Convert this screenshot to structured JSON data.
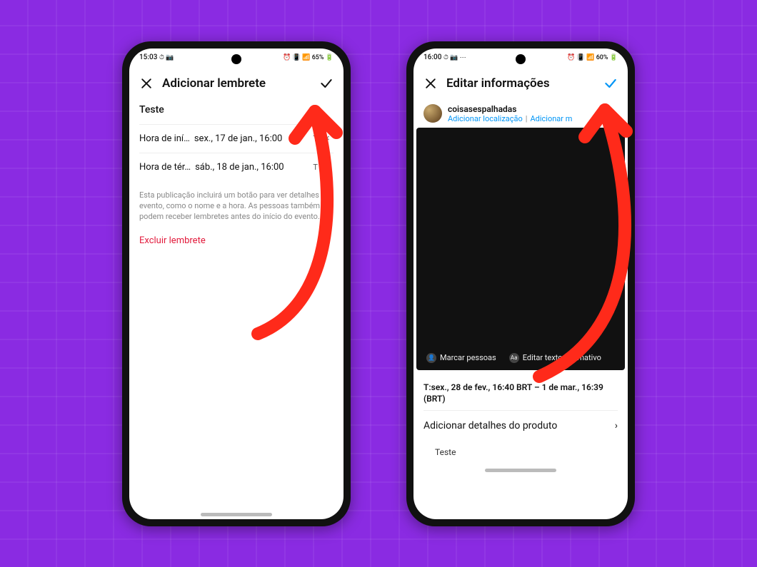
{
  "colors": {
    "accent": "#0095f6",
    "danger": "#e21b3c",
    "bg": "#8a2be2"
  },
  "phone1": {
    "statusbar": {
      "time": "15:03",
      "left_icons": "⏱ 📷",
      "right_icons": "⏰ 📳 📶 65% 🔋",
      "battery": "65%"
    },
    "appbar": {
      "title": "Adicionar lembrete"
    },
    "title": "Teste",
    "start": {
      "label": "Hora de iní…",
      "value": "sex., 17 de jan., 16:00",
      "tz": "T"
    },
    "end": {
      "label": "Hora de tér…",
      "value": "sáb., 18 de jan., 16:00",
      "tz": "T"
    },
    "note": "Esta publicação incluirá um botão para ver detalhes do evento, como o nome e a hora. As pessoas também podem receber lembretes antes do início do evento.",
    "delete": "Excluir lembrete"
  },
  "phone2": {
    "statusbar": {
      "time": "16:00",
      "left_icons": "⏱ 📷 ⋯",
      "right_icons": "⏰ 📳 📶 60% 🔋",
      "battery": "60%"
    },
    "appbar": {
      "title": "Editar informações"
    },
    "user": {
      "name": "coisasespalhadas",
      "add_location": "Adicionar localização",
      "add_more": "Adicionar m"
    },
    "media_actions": {
      "tag": "Marcar pessoas",
      "alt": "Editar texto alternativo"
    },
    "event_date": "T:sex., 28 de fev., 16:40 BRT – 1 de mar., 16:39 (BRT)",
    "product_row": "Adicionar detalhes do produto",
    "caption": "Teste"
  }
}
